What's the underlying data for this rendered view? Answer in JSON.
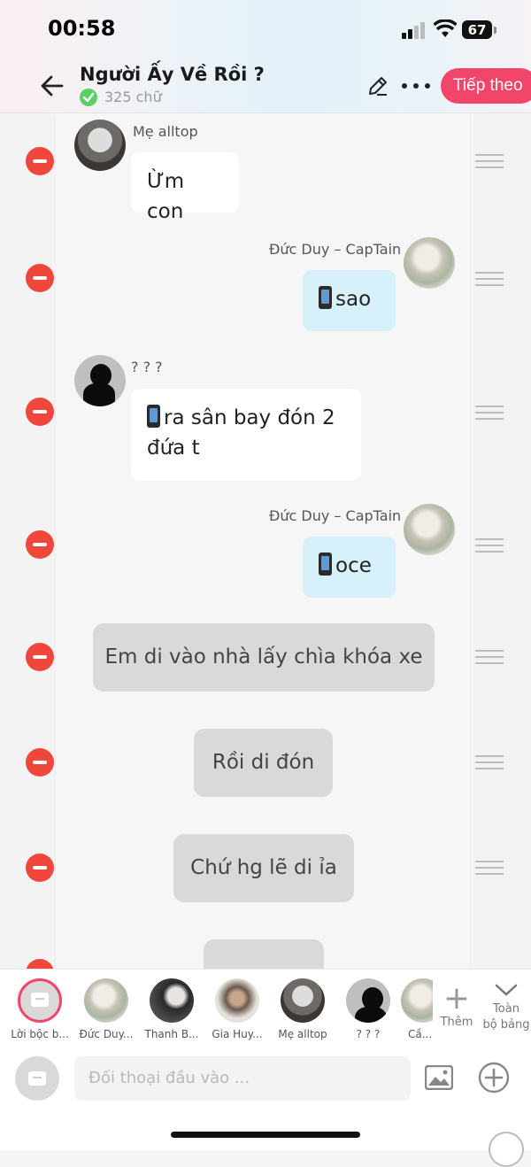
{
  "status_bar": {
    "time": "00:58",
    "battery": "67"
  },
  "header": {
    "title": "Người Ấy Về Rồi ?",
    "word_count": "325 chữ",
    "next_label": "Tiếp theo"
  },
  "messages": [
    {
      "speaker": "Mẹ alltop",
      "text": "Ừm con"
    },
    {
      "speaker": "Đức Duy – CapTain",
      "text": "sao"
    },
    {
      "speaker": "? ? ?",
      "text": "ra sân bay đón 2 đứa t"
    },
    {
      "speaker": "Đức Duy – CapTain",
      "text": "oce"
    },
    {
      "text": "Em di vào nhà lấy chìa khóa xe"
    },
    {
      "text": "Rồi di đón"
    },
    {
      "text": "Chứ hg lẽ di ỉa"
    }
  ],
  "characters": [
    {
      "label": "Lời bộc b...",
      "selected": true
    },
    {
      "label": "Đức Duy..."
    },
    {
      "label": "Thanh B..."
    },
    {
      "label": "Gia Huy..."
    },
    {
      "label": "Mẹ alltop"
    },
    {
      "label": "? ? ?"
    },
    {
      "label": "Cầ..."
    }
  ],
  "add_character_label": "Thêm",
  "expand_label_line1": "Toàn",
  "expand_label_line2": "bộ bảng",
  "composer": {
    "placeholder": "Đối thoại đầu vào ..."
  },
  "colors": {
    "accent": "#f2456a",
    "delete": "#f0473d",
    "right_bubble": "#d7f1fb",
    "narration_bubble": "#d9d9d9"
  }
}
